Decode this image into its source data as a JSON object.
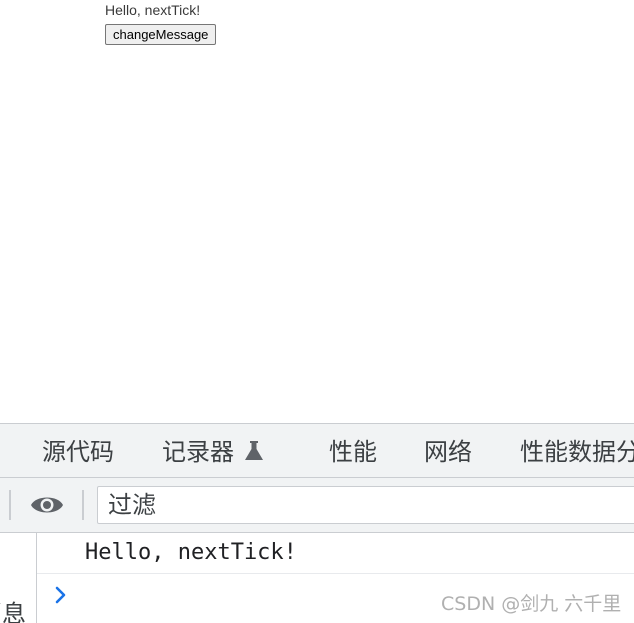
{
  "page": {
    "message": "Hello, nextTick!",
    "button_label": "changeMessage"
  },
  "devtools": {
    "tabs": [
      {
        "label": "源代码"
      },
      {
        "label": "记录器"
      },
      {
        "label": "性能"
      },
      {
        "label": "网络"
      },
      {
        "label": "性能数据分"
      }
    ],
    "recorder_badge_icon": "flask-icon",
    "toolbar": {
      "eye_icon": "eye-icon",
      "filter_placeholder": "过滤"
    },
    "sidebar": {
      "label": "消息"
    },
    "console": {
      "logs": [
        {
          "text": "Hello, nextTick!"
        }
      ],
      "prompt_icon": "chevron-right-icon"
    }
  },
  "watermark": "CSDN @剑九 六千里",
  "colors": {
    "devtools_bg": "#f1f3f4",
    "border": "#cacdd1",
    "text": "#3c4043",
    "prompt_blue": "#1a73e8",
    "watermark": "#b0b0b0"
  }
}
